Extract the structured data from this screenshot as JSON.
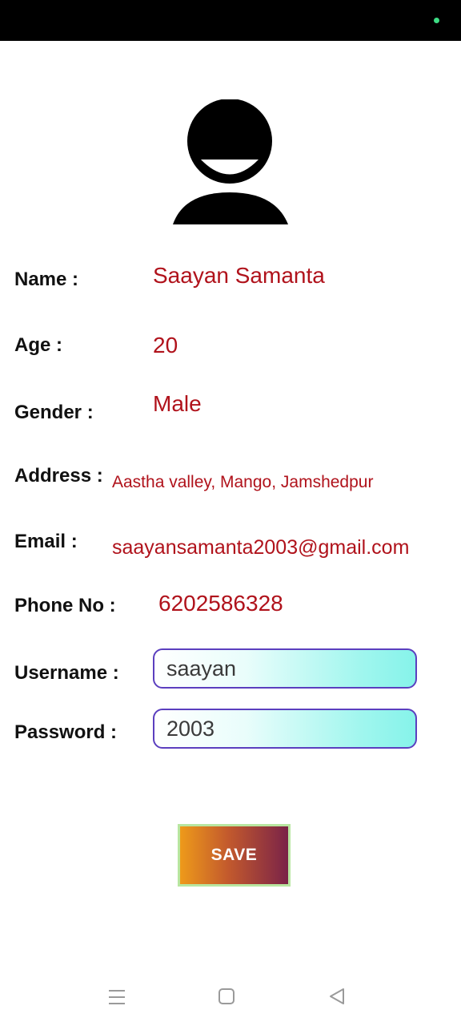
{
  "profile": {
    "name_label": "Name :",
    "name_value": "Saayan Samanta",
    "age_label": "Age :",
    "age_value": "20",
    "gender_label": "Gender :",
    "gender_value": "Male",
    "address_label": "Address :",
    "address_value": "Aastha valley, Mango, Jamshedpur",
    "email_label": "Email :",
    "email_value": "saayansamanta2003@gmail.com",
    "phone_label": "Phone No :",
    "phone_value": "6202586328"
  },
  "credentials": {
    "username_label": "Username :",
    "username_value": "saayan",
    "password_label": "Password :",
    "password_value": "2003"
  },
  "actions": {
    "save_label": "SAVE"
  },
  "icons": {
    "avatar": "person-icon",
    "nav_menu": "menu-icon",
    "nav_home": "square-home-icon",
    "nav_back": "triangle-back-icon"
  },
  "colors": {
    "value_text": "#b0121b",
    "field_border": "#5b3fbf",
    "status_dot": "#3ddc84"
  }
}
